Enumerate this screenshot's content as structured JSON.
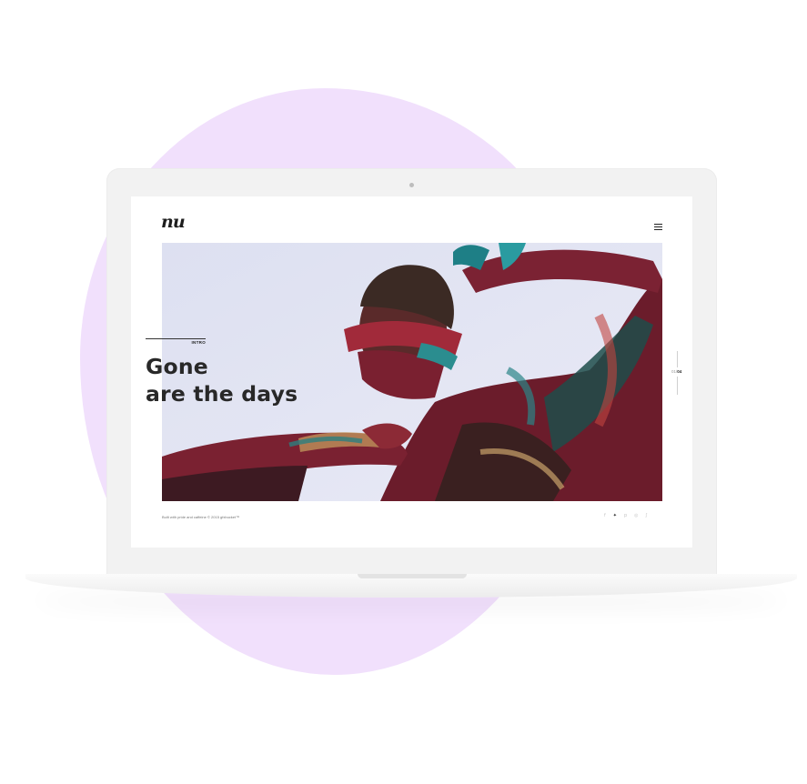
{
  "brand": {
    "logo_text": "nu"
  },
  "hero": {
    "section_label": "INTRO",
    "headline_line1": "Gone",
    "headline_line2": "are the days"
  },
  "pager": {
    "current": "01",
    "total": "04"
  },
  "footer": {
    "credit": "Built with pride and caffeine © 2015 gfxbucket™",
    "social": [
      {
        "icon": "facebook-icon",
        "glyph": "f"
      },
      {
        "icon": "twitter-icon",
        "glyph": "✦"
      },
      {
        "icon": "pinterest-icon",
        "glyph": "p"
      },
      {
        "icon": "instagram-icon",
        "glyph": "◎"
      },
      {
        "icon": "rss-icon",
        "glyph": "ʃ"
      }
    ]
  },
  "colors": {
    "background_blob": "#f1e0fc",
    "laptop_frame": "#f2f2f2",
    "heading_text": "#282828",
    "hero_backdrop": "#e2e4f2"
  }
}
